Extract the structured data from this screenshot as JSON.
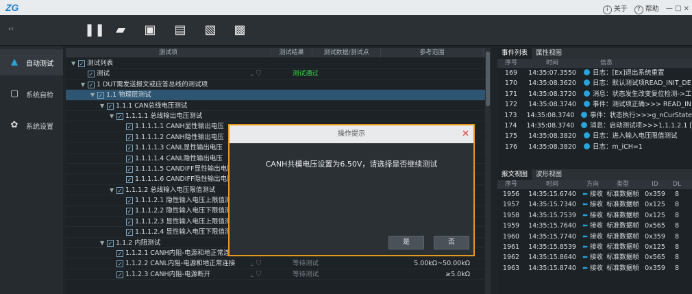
{
  "titlebar": {
    "about": "关于",
    "help": "帮助",
    "win": "— □ ×"
  },
  "sidebar": [
    {
      "label": "自动测试",
      "icon": "triangle-logo-icon"
    },
    {
      "label": "系统自检",
      "icon": "monitor-icon"
    },
    {
      "label": "系统设置",
      "icon": "gear-icon"
    }
  ],
  "table": {
    "headers": [
      "测试项",
      "测试结果",
      "测试数据/测试点",
      "参考范围"
    ],
    "rows": [
      {
        "name": "测试列表",
        "lvl": 0,
        "exp": true,
        "res": "",
        "rng": ""
      },
      {
        "name": "测试",
        "lvl": 1,
        "exp": false,
        "ic": true,
        "res": "测试通过",
        "rng": ""
      },
      {
        "name": "1 DUT需发送报文或应答总线的测试项",
        "lvl": 1,
        "exp": true,
        "res": "",
        "rng": ""
      },
      {
        "name": "1.1 物理层测试",
        "lvl": 2,
        "exp": true,
        "res": "",
        "rng": ""
      },
      {
        "name": "1.1.1 CAN总线电压测试",
        "lvl": 3,
        "exp": true,
        "res": "",
        "rng": ""
      },
      {
        "name": "1.1.1.1 总线输出电压测试",
        "lvl": 4,
        "exp": true,
        "res": "",
        "rng": ""
      },
      {
        "name": "1.1.1.1.1 CANH显性输出电压",
        "lvl": 5,
        "exp": false,
        "res": "",
        "rng": ""
      },
      {
        "name": "1.1.1.1.2 CANH隐性输出电压",
        "lvl": 5,
        "exp": false,
        "res": "",
        "rng": ""
      },
      {
        "name": "1.1.1.1.3 CANL显性输出电压",
        "lvl": 5,
        "exp": false,
        "res": "",
        "rng": ""
      },
      {
        "name": "1.1.1.1.4 CANL隐性输出电压",
        "lvl": 5,
        "exp": false,
        "res": "",
        "rng": ""
      },
      {
        "name": "1.1.1.1.5 CANDIFF显性输出电压",
        "lvl": 5,
        "exp": false,
        "res": "",
        "rng": ""
      },
      {
        "name": "1.1.1.1.6 CANDIFF隐性输出电压",
        "lvl": 5,
        "exp": false,
        "res": "",
        "rng": ""
      },
      {
        "name": "1.1.1.2 总线输入电压限值测试",
        "lvl": 4,
        "exp": true,
        "res": "",
        "rng": ""
      },
      {
        "name": "1.1.1.2.1 隐性输入电压上限值测",
        "lvl": 5,
        "exp": false,
        "res": "",
        "rng": ""
      },
      {
        "name": "1.1.1.2.2 隐性输入电压下限值测",
        "lvl": 5,
        "exp": false,
        "res": "",
        "rng": ""
      },
      {
        "name": "1.1.1.2.3 显性输入电压上限值测",
        "lvl": 5,
        "exp": false,
        "res": "",
        "rng": ""
      },
      {
        "name": "1.1.1.2.4 显性输入电压下限值测",
        "lvl": 5,
        "exp": false,
        "res": "",
        "rng": ""
      },
      {
        "name": "1.1.2 内阻测试",
        "lvl": 3,
        "exp": true,
        "res": "",
        "rng": ""
      },
      {
        "name": "1.1.2.1 CANH内阻-电源和地正常连接",
        "lvl": 4,
        "exp": false,
        "ic": true,
        "res": "等待测试",
        "rng": "5.00kΩ~50.00kΩ"
      },
      {
        "name": "1.1.2.2 CANL内阻-电源和地正常连接",
        "lvl": 4,
        "exp": false,
        "ic": true,
        "res": "等待测试",
        "rng": "5.00kΩ~50.00kΩ"
      },
      {
        "name": "1.1.2.3 CANH内阻-电源断开",
        "lvl": 4,
        "exp": false,
        "ic": true,
        "res": "等待测试",
        "rng": "≥5.0kΩ"
      }
    ]
  },
  "events": {
    "tabs": [
      "事件列表",
      "属性视图"
    ],
    "headers": [
      "序号",
      "时间",
      "信息"
    ],
    "rows": [
      [
        "169",
        "14:35:07.3550",
        "日志：[Ex]退出系统重置"
      ],
      [
        "170",
        "14:35:08.3620",
        "日志：默认测试项READ_INIT_DE"
      ],
      [
        "171",
        "14:35:08.3720",
        "消息：状态发生改变复位检测->工"
      ],
      [
        "172",
        "14:35:08.3740",
        "事件：测试项正确>>> READ_IN"
      ],
      [
        "173",
        "14:35:08.3740",
        "事件：状态执行>>>g_nCurState"
      ],
      [
        "174",
        "14:35:08.3740",
        "消息：启动测试项>>>1.1.1.2.1 ["
      ],
      [
        "175",
        "14:35:08.3820",
        "日志：进入输入电压限值测试"
      ],
      [
        "176",
        "14:35:08.3820",
        "日志：m_iCH=1"
      ]
    ]
  },
  "frames": {
    "tabs": [
      "报文视图",
      "波形视图"
    ],
    "headers": [
      "序号",
      "时间",
      "方向",
      "类型",
      "ID",
      "DL"
    ],
    "rows": [
      [
        "1956",
        "14:35:15.6740",
        "接收",
        "标准数据帧",
        "0x359",
        "8"
      ],
      [
        "1957",
        "14:35:15.7340",
        "接收",
        "标准数据帧",
        "0x125",
        "8"
      ],
      [
        "1958",
        "14:35:15.7539",
        "接收",
        "标准数据帧",
        "0x125",
        "8"
      ],
      [
        "1959",
        "14:35:15.7640",
        "接收",
        "标准数据帧",
        "0x565",
        "8"
      ],
      [
        "1960",
        "14:35:15.7740",
        "接收",
        "标准数据帧",
        "0x359",
        "8"
      ],
      [
        "1961",
        "14:35:15.8539",
        "接收",
        "标准数据帧",
        "0x125",
        "8"
      ],
      [
        "1962",
        "14:35:15.8640",
        "接收",
        "标准数据帧",
        "0x565",
        "8"
      ],
      [
        "1963",
        "14:35:15.8740",
        "接收",
        "标准数据帧",
        "0x359",
        "8"
      ]
    ]
  },
  "modal": {
    "title": "操作提示",
    "message": "CANH共模电压设置为6.50V，请选择是否继续测试",
    "yes": "是",
    "no": "否"
  }
}
